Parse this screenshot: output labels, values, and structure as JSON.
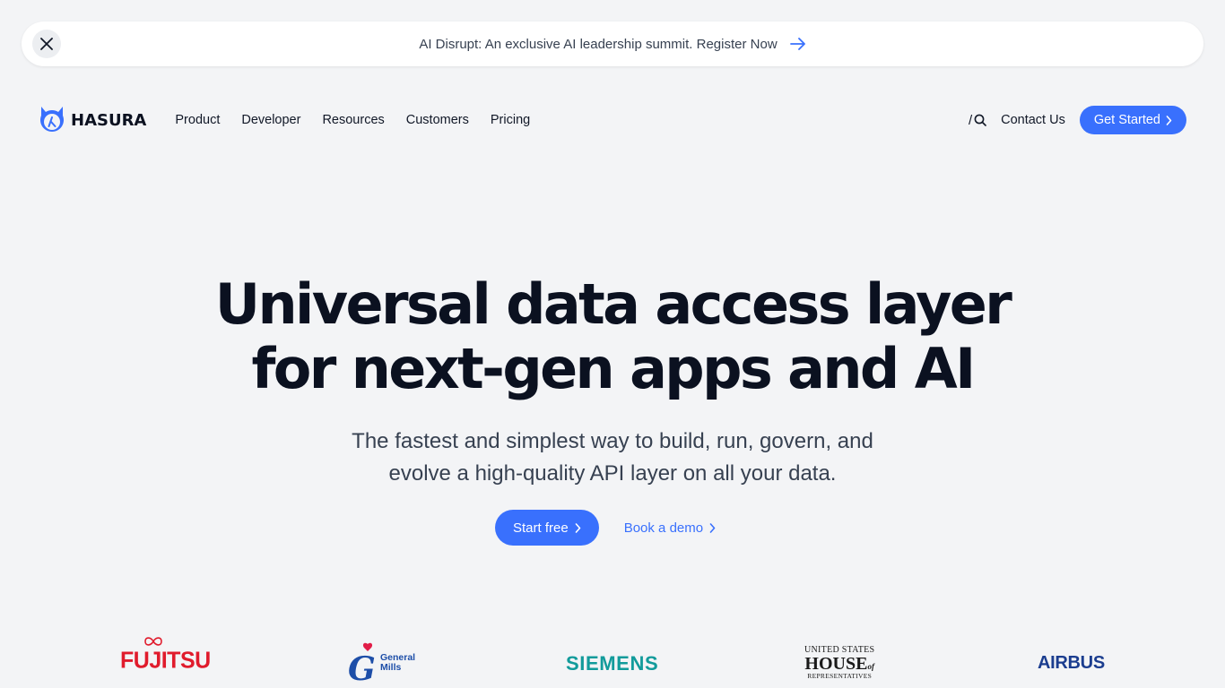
{
  "banner": {
    "text": "AI Disrupt: An exclusive AI leadership summit. Register Now",
    "close_icon": "close-icon",
    "arrow_icon": "arrow-right-icon"
  },
  "nav": {
    "logo_text": "HASURA",
    "links": [
      "Product",
      "Developer",
      "Resources",
      "Customers",
      "Pricing"
    ],
    "search_shortcut": "/",
    "contact": "Contact Us",
    "get_started": "Get Started"
  },
  "hero": {
    "title_line1": "Universal data access layer",
    "title_line2": "for next-gen apps and AI",
    "subtitle": "The fastest and simplest way to build, run, govern, and evolve a high-quality API layer on all your data.",
    "primary_cta": "Start free",
    "secondary_cta": "Book a demo"
  },
  "customers": {
    "fujitsu": "FUJITSU",
    "general_mills_line1": "General",
    "general_mills_line2": "Mills",
    "siemens": "SIEMENS",
    "house_line1": "UNITED STATES",
    "house_line2": "HOUSE",
    "house_of": "of",
    "house_line3": "REPRESENTATIVES",
    "airbus": "AIRBUS"
  },
  "colors": {
    "accent": "#3970fd",
    "background": "#f3f4f6",
    "heading": "#0b1120"
  }
}
